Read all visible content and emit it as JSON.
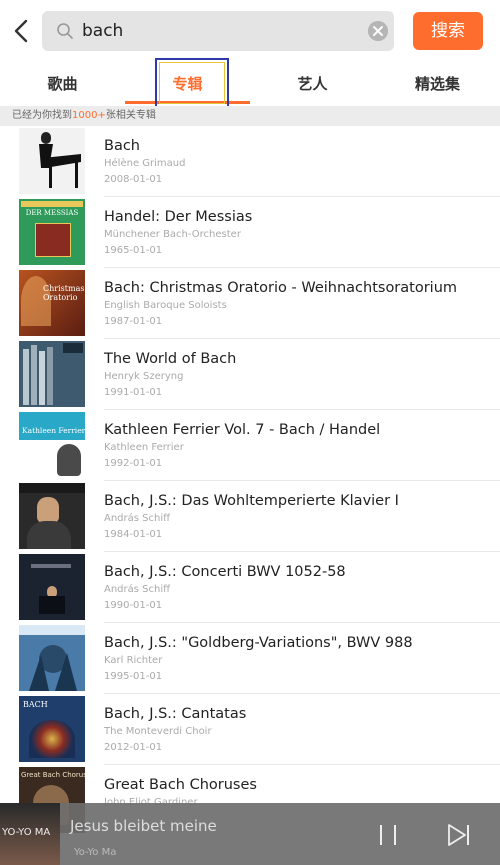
{
  "search": {
    "query": "bach",
    "button_label": "搜索"
  },
  "tabs": [
    {
      "label": "歌曲"
    },
    {
      "label": "专辑"
    },
    {
      "label": "艺人"
    },
    {
      "label": "精选集"
    }
  ],
  "results_info": {
    "prefix": "已经为你找到",
    "count": "1000+",
    "suffix": "张相关专辑"
  },
  "albums": [
    {
      "title": "Bach",
      "artist": "Hélène Grimaud",
      "date": "2008-01-01"
    },
    {
      "title": "Handel: Der Messias",
      "artist": "Münchener Bach-Orchester",
      "date": "1965-01-01",
      "cover_text": "DER MESSIAS"
    },
    {
      "title": "Bach: Christmas Oratorio - Weihnachtsoratorium",
      "artist": "English Baroque Soloists",
      "date": "1987-01-01",
      "cover_text": "Christmas Oratorio"
    },
    {
      "title": "The World of Bach",
      "artist": "Henryk Szeryng",
      "date": "1991-01-01"
    },
    {
      "title": "Kathleen Ferrier Vol. 7 - Bach / Handel",
      "artist": "Kathleen Ferrier",
      "date": "1992-01-01",
      "cover_text": "Kathleen Ferrier"
    },
    {
      "title": "Bach, J.S.: Das Wohltemperierte Klavier I",
      "artist": "András Schiff",
      "date": "1984-01-01"
    },
    {
      "title": "Bach, J.S.: Concerti BWV 1052-58",
      "artist": "András Schiff",
      "date": "1990-01-01"
    },
    {
      "title": "Bach, J.S.: \"Goldberg-Variations\", BWV 988",
      "artist": "Karl Richter",
      "date": "1995-01-01"
    },
    {
      "title": "Bach, J.S.: Cantatas",
      "artist": "The Monteverdi Choir",
      "date": "2012-01-01",
      "cover_text": "BACH"
    },
    {
      "title": "Great Bach Choruses",
      "artist": "John Eliot Gardiner",
      "date": "",
      "cover_text": "Great Bach Choruses"
    }
  ],
  "player": {
    "title": "Jesus bleibet meine",
    "artist": "Yo-Yo Ma",
    "art_text": "YO-YO MA"
  },
  "colors": {
    "accent": "#ff6d2e",
    "focus_outline": "#2e3aa8"
  }
}
